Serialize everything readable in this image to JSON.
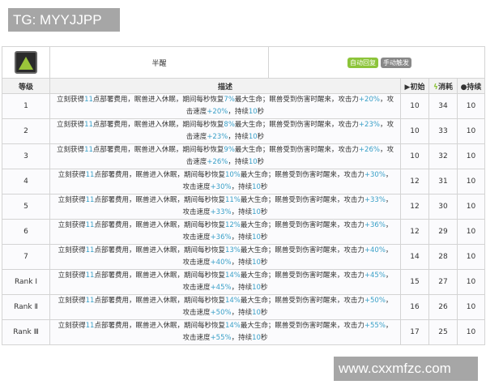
{
  "watermarks": {
    "top_left": "TG: MYYJJPP",
    "bottom_right": "www.cxxmfzc.com"
  },
  "skill": {
    "icon": "skill-icon",
    "name": "半醒",
    "tags": [
      {
        "label": "自动回复",
        "color": "#8cc43a"
      },
      {
        "label": "手动触发",
        "color": "#888888"
      }
    ]
  },
  "headers": {
    "level": "等级",
    "description": "描述",
    "initial": "初始",
    "cost": "消耗",
    "duration": "持续",
    "initial_icon": "play-icon",
    "cost_icon": "lightning-icon",
    "duration_icon": "clock-icon"
  },
  "colors": {
    "highlight": "#3aa0c8"
  },
  "rows": [
    {
      "level": "1",
      "segments": [
        {
          "t": "立刻获得"
        },
        {
          "t": "11",
          "hl": true
        },
        {
          "t": "点部署费用，眠兽进入休眠，期间每秒恢复"
        },
        {
          "t": "7%",
          "hl": true
        },
        {
          "t": "最大生命；眠兽受到伤害时醒来，攻击力"
        },
        {
          "t": "+20%",
          "hl": true
        },
        {
          "t": "，攻击速度"
        },
        {
          "t": "+20%",
          "hl": true
        },
        {
          "t": "，持续"
        },
        {
          "t": "10",
          "hl": true
        },
        {
          "t": "秒"
        }
      ],
      "initial": "10",
      "cost": "34",
      "duration": "10"
    },
    {
      "level": "2",
      "segments": [
        {
          "t": "立刻获得"
        },
        {
          "t": "11",
          "hl": true
        },
        {
          "t": "点部署费用，眠兽进入休眠，期间每秒恢复"
        },
        {
          "t": "8%",
          "hl": true
        },
        {
          "t": "最大生命；眠兽受到伤害时醒来，攻击力"
        },
        {
          "t": "+23%",
          "hl": true
        },
        {
          "t": "，攻击速度"
        },
        {
          "t": "+23%",
          "hl": true
        },
        {
          "t": "，持续"
        },
        {
          "t": "10",
          "hl": true
        },
        {
          "t": "秒"
        }
      ],
      "initial": "10",
      "cost": "33",
      "duration": "10"
    },
    {
      "level": "3",
      "segments": [
        {
          "t": "立刻获得"
        },
        {
          "t": "11",
          "hl": true
        },
        {
          "t": "点部署费用，眠兽进入休眠，期间每秒恢复"
        },
        {
          "t": "9%",
          "hl": true
        },
        {
          "t": "最大生命；眠兽受到伤害时醒来，攻击力"
        },
        {
          "t": "+26%",
          "hl": true
        },
        {
          "t": "，攻击速度"
        },
        {
          "t": "+26%",
          "hl": true
        },
        {
          "t": "，持续"
        },
        {
          "t": "10",
          "hl": true
        },
        {
          "t": "秒"
        }
      ],
      "initial": "10",
      "cost": "32",
      "duration": "10"
    },
    {
      "level": "4",
      "segments": [
        {
          "t": "立刻获得"
        },
        {
          "t": "11",
          "hl": true
        },
        {
          "t": "点部署费用，眠兽进入休眠，期间每秒恢复"
        },
        {
          "t": "10%",
          "hl": true
        },
        {
          "t": "最大生命；眠兽受到伤害时醒来，攻击力"
        },
        {
          "t": "+30%",
          "hl": true
        },
        {
          "t": "，攻击速度"
        },
        {
          "t": "+30%",
          "hl": true
        },
        {
          "t": "，持续"
        },
        {
          "t": "10",
          "hl": true
        },
        {
          "t": "秒"
        }
      ],
      "initial": "12",
      "cost": "31",
      "duration": "10"
    },
    {
      "level": "5",
      "segments": [
        {
          "t": "立刻获得"
        },
        {
          "t": "11",
          "hl": true
        },
        {
          "t": "点部署费用，眠兽进入休眠，期间每秒恢复"
        },
        {
          "t": "11%",
          "hl": true
        },
        {
          "t": "最大生命；眠兽受到伤害时醒来，攻击力"
        },
        {
          "t": "+33%",
          "hl": true
        },
        {
          "t": "，攻击速度"
        },
        {
          "t": "+33%",
          "hl": true
        },
        {
          "t": "，持续"
        },
        {
          "t": "10",
          "hl": true
        },
        {
          "t": "秒"
        }
      ],
      "initial": "12",
      "cost": "30",
      "duration": "10"
    },
    {
      "level": "6",
      "segments": [
        {
          "t": "立刻获得"
        },
        {
          "t": "11",
          "hl": true
        },
        {
          "t": "点部署费用，眠兽进入休眠，期间每秒恢复"
        },
        {
          "t": "12%",
          "hl": true
        },
        {
          "t": "最大生命；眠兽受到伤害时醒来，攻击力"
        },
        {
          "t": "+36%",
          "hl": true
        },
        {
          "t": "，攻击速度"
        },
        {
          "t": "+36%",
          "hl": true
        },
        {
          "t": "，持续"
        },
        {
          "t": "10",
          "hl": true
        },
        {
          "t": "秒"
        }
      ],
      "initial": "12",
      "cost": "29",
      "duration": "10"
    },
    {
      "level": "7",
      "segments": [
        {
          "t": "立刻获得"
        },
        {
          "t": "11",
          "hl": true
        },
        {
          "t": "点部署费用，眠兽进入休眠，期间每秒恢复"
        },
        {
          "t": "13%",
          "hl": true
        },
        {
          "t": "最大生命；眠兽受到伤害时醒来，攻击力"
        },
        {
          "t": "+40%",
          "hl": true
        },
        {
          "t": "，攻击速度"
        },
        {
          "t": "+40%",
          "hl": true
        },
        {
          "t": "，持续"
        },
        {
          "t": "10",
          "hl": true
        },
        {
          "t": "秒"
        }
      ],
      "initial": "14",
      "cost": "28",
      "duration": "10"
    },
    {
      "level": "Rank Ⅰ",
      "segments": [
        {
          "t": "立刻获得"
        },
        {
          "t": "11",
          "hl": true
        },
        {
          "t": "点部署费用，眠兽进入休眠，期间每秒恢复"
        },
        {
          "t": "14%",
          "hl": true
        },
        {
          "t": "最大生命；眠兽受到伤害时醒来，攻击力"
        },
        {
          "t": "+45%",
          "hl": true
        },
        {
          "t": "，攻击速度"
        },
        {
          "t": "+45%",
          "hl": true
        },
        {
          "t": "，持续"
        },
        {
          "t": "10",
          "hl": true
        },
        {
          "t": "秒"
        }
      ],
      "initial": "15",
      "cost": "27",
      "duration": "10"
    },
    {
      "level": "Rank Ⅱ",
      "segments": [
        {
          "t": "立刻获得"
        },
        {
          "t": "11",
          "hl": true
        },
        {
          "t": "点部署费用，眠兽进入休眠，期间每秒恢复"
        },
        {
          "t": "14%",
          "hl": true
        },
        {
          "t": "最大生命；眠兽受到伤害时醒来，攻击力"
        },
        {
          "t": "+50%",
          "hl": true
        },
        {
          "t": "，攻击速度"
        },
        {
          "t": "+50%",
          "hl": true
        },
        {
          "t": "，持续"
        },
        {
          "t": "10",
          "hl": true
        },
        {
          "t": "秒"
        }
      ],
      "initial": "16",
      "cost": "26",
      "duration": "10"
    },
    {
      "level": "Rank Ⅲ",
      "segments": [
        {
          "t": "立刻获得"
        },
        {
          "t": "11",
          "hl": true
        },
        {
          "t": "点部署费用，眠兽进入休眠，期间每秒恢复"
        },
        {
          "t": "14%",
          "hl": true
        },
        {
          "t": "最大生命；眠兽受到伤害时醒来，攻击力"
        },
        {
          "t": "+55%",
          "hl": true
        },
        {
          "t": "，攻击速度"
        },
        {
          "t": "+55%",
          "hl": true
        },
        {
          "t": "，持续"
        },
        {
          "t": "10",
          "hl": true
        },
        {
          "t": "秒"
        }
      ],
      "initial": "17",
      "cost": "25",
      "duration": "10"
    }
  ]
}
